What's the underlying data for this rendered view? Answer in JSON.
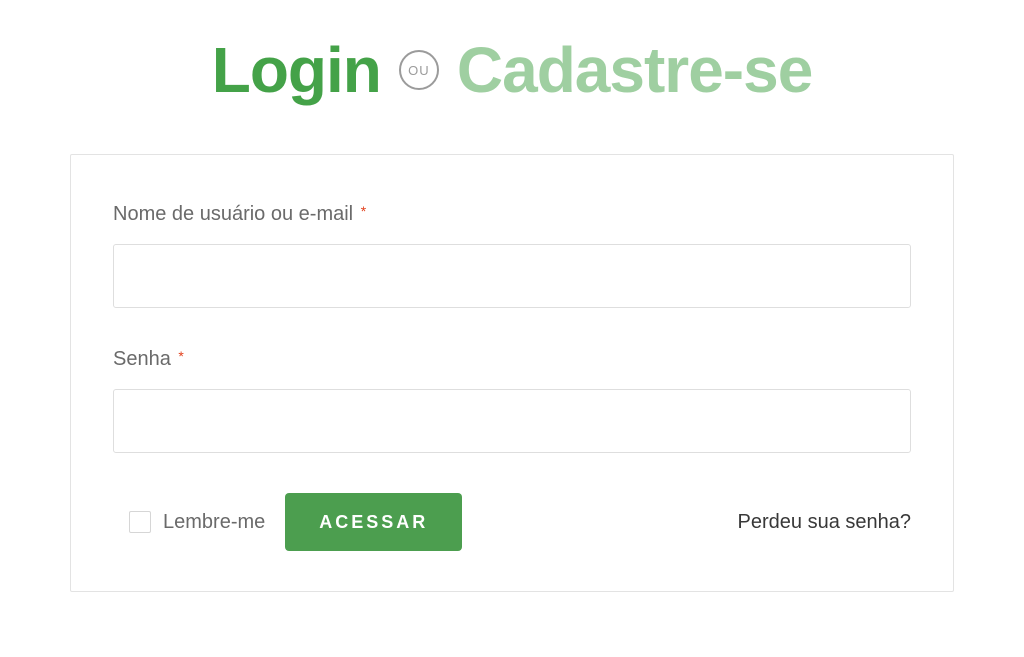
{
  "tabs": {
    "login": "Login",
    "or": "OU",
    "register": "Cadastre-se"
  },
  "form": {
    "username_label": "Nome de usuário ou e-mail",
    "username_value": "",
    "password_label": "Senha",
    "password_value": "",
    "remember_label": "Lembre-me",
    "submit_label": "ACESSAR",
    "lost_password": "Perdeu sua senha?",
    "required_mark": "*"
  },
  "colors": {
    "primary": "#44a248",
    "primary_light": "#9fcfa1",
    "button": "#4c9e4f",
    "text_muted": "#6a6a6a",
    "border": "#e3e3e3",
    "required": "#e2401c"
  }
}
